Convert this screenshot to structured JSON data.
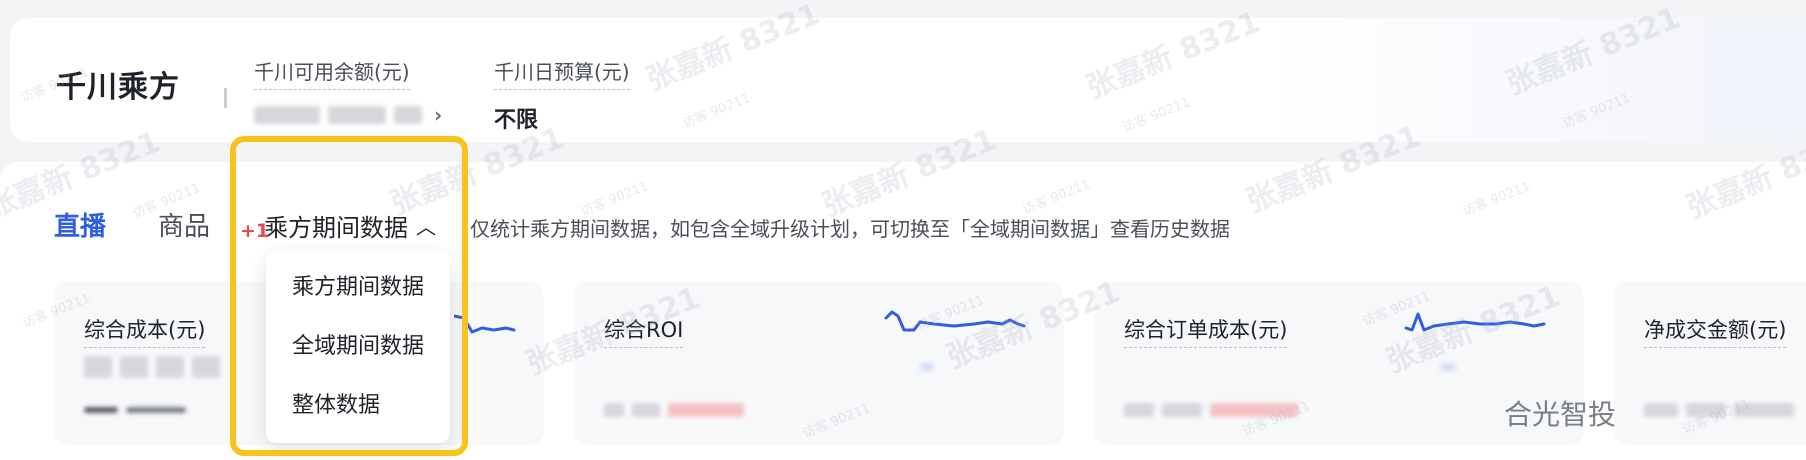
{
  "header": {
    "title": "千川乘方",
    "available_balance": {
      "label": "千川可用余额(元)",
      "value": ""
    },
    "daily_budget": {
      "label": "千川日预算(元)",
      "value": "不限"
    }
  },
  "tabs": [
    {
      "label": "直播",
      "active": true
    },
    {
      "label": "商品",
      "active": false
    }
  ],
  "period_selector": {
    "selected": "乘方期间数据",
    "hint": "仅统计乘方期间数据，如包含全域升级计划，可切换至「全域期间数据」查看历史数据",
    "options": [
      "乘方期间数据",
      "全域期间数据",
      "整体数据"
    ]
  },
  "metric_cards": [
    {
      "title": "综合成本(元)",
      "delta": "+1"
    },
    {
      "title": "综合ROI"
    },
    {
      "title": "综合订单成本(元)"
    },
    {
      "title": "净成交金额(元)"
    }
  ],
  "watermarks": {
    "name": "张嘉新 8321",
    "visitor": "访客 90211",
    "brand": "合光智投"
  },
  "colors": {
    "accent": "#2f5fe0",
    "highlight": "#f8c31c",
    "spark": "#2f5fe0",
    "negative": "#e5484d"
  }
}
